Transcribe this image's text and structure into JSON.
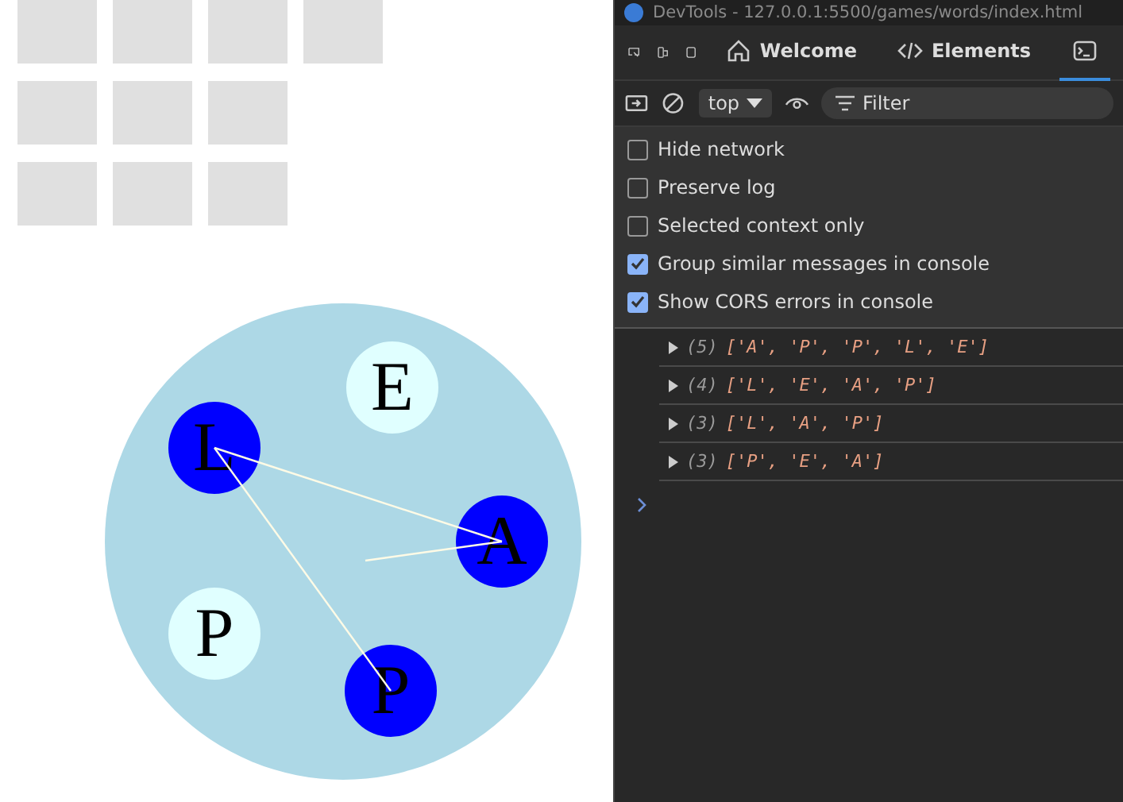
{
  "game": {
    "letters": [
      {
        "letter": "E",
        "selected": false
      },
      {
        "letter": "L",
        "selected": true
      },
      {
        "letter": "A",
        "selected": true
      },
      {
        "letter": "P",
        "selected": false
      },
      {
        "letter": "P",
        "selected": true
      }
    ]
  },
  "devtools": {
    "title": "DevTools - 127.0.0.1:5500/games/words/index.html",
    "tabs": [
      {
        "label": "Welcome",
        "kind": "home",
        "selected": false
      },
      {
        "label": "Elements",
        "kind": "code",
        "selected": false
      },
      {
        "kind": "console",
        "selected": true
      }
    ],
    "context": "top",
    "filter_placeholder": "Filter",
    "settings": [
      {
        "label": "Hide network",
        "checked": false
      },
      {
        "label": "Preserve log",
        "checked": false
      },
      {
        "label": "Selected context only",
        "checked": false
      },
      {
        "label": "Group similar messages in console",
        "checked": true
      },
      {
        "label": "Show CORS errors in console",
        "checked": true
      }
    ],
    "logs": [
      {
        "count": "(5)",
        "value": "['A', 'P', 'P', 'L', 'E']"
      },
      {
        "count": "(4)",
        "value": "['L', 'E', 'A', 'P']"
      },
      {
        "count": "(3)",
        "value": "['L', 'A', 'P']"
      },
      {
        "count": "(3)",
        "value": "['P', 'E', 'A']"
      }
    ]
  }
}
